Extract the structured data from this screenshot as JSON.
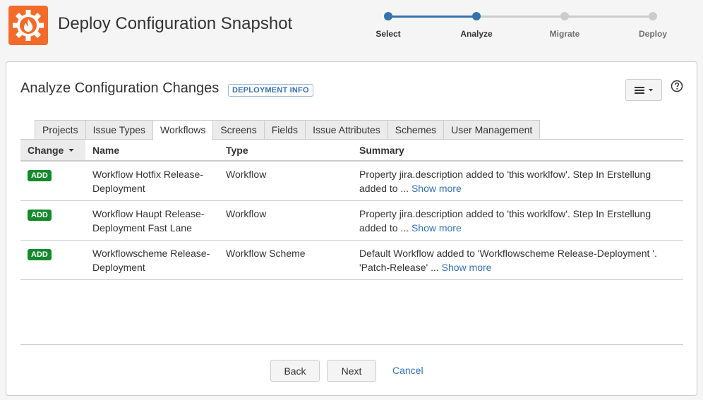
{
  "header": {
    "title": "Deploy Configuration Snapshot",
    "logo_icon": "flame-gear-icon",
    "brand_color": "#f26b2a"
  },
  "stepper": {
    "current_step": 2,
    "active_color": "#3572b0",
    "inactive_color": "#cccccc",
    "steps": [
      {
        "label": "Select"
      },
      {
        "label": "Analyze"
      },
      {
        "label": "Migrate"
      },
      {
        "label": "Deploy"
      }
    ]
  },
  "panel": {
    "title": "Analyze Configuration Changes",
    "lozenge": "DEPLOYMENT INFO",
    "menu_icon": "hamburger-menu-icon",
    "help_icon": "question-circle-icon"
  },
  "tabs": [
    {
      "label": "Projects",
      "active": false
    },
    {
      "label": "Issue Types",
      "active": false
    },
    {
      "label": "Workflows",
      "active": true
    },
    {
      "label": "Screens",
      "active": false
    },
    {
      "label": "Fields",
      "active": false
    },
    {
      "label": "Issue Attributes",
      "active": false
    },
    {
      "label": "Schemes",
      "active": false
    },
    {
      "label": "User Management",
      "active": false
    }
  ],
  "table": {
    "columns": {
      "change": "Change",
      "name": "Name",
      "type": "Type",
      "summary": "Summary"
    },
    "sort_icon": "caret-down-icon",
    "rows": [
      {
        "change": "ADD",
        "name": "Workflow Hotfix Release-Deployment",
        "type": "Workflow",
        "summary": "Property jira.description added to 'this worklfow'. Step In Erstellung added to  ...",
        "show_more": "Show more"
      },
      {
        "change": "ADD",
        "name": "Workflow Haupt Release-Deployment Fast Lane",
        "type": "Workflow",
        "summary": "Property jira.description added to 'this worklfow'. Step In Erstellung added to  ...",
        "show_more": "Show more"
      },
      {
        "change": "ADD",
        "name": "Workflowscheme Release-Deployment",
        "type": "Workflow Scheme",
        "summary": "Default Workflow added to 'Workflowscheme Release-Deployment '. 'Patch-Release' ...",
        "show_more": "Show more"
      }
    ]
  },
  "footer": {
    "back": "Back",
    "next": "Next",
    "cancel": "Cancel"
  }
}
